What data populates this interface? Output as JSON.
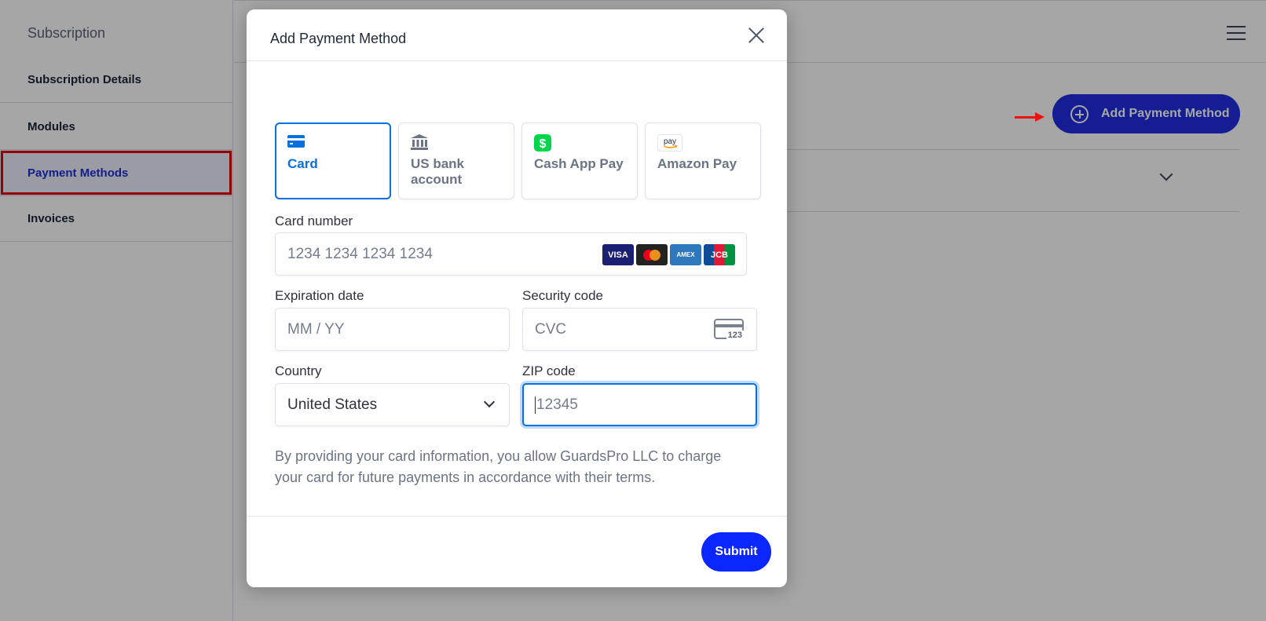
{
  "sidebar": {
    "title": "Subscription",
    "items": [
      {
        "label": "Subscription Details"
      },
      {
        "label": "Modules"
      },
      {
        "label": "Payment Methods"
      },
      {
        "label": "Invoices"
      }
    ]
  },
  "main": {
    "add_button_label": "Add Payment Method"
  },
  "modal": {
    "title": "Add Payment Method",
    "tabs": [
      {
        "label": "Card",
        "icon": "card-icon"
      },
      {
        "label": "US bank account",
        "icon": "bank-icon"
      },
      {
        "label": "Cash App Pay",
        "icon": "cash-app-icon"
      },
      {
        "label": "Amazon Pay",
        "icon": "amazon-pay-icon"
      }
    ],
    "card_number": {
      "label": "Card number",
      "placeholder": "1234 1234 1234 1234",
      "brands": [
        "VISA",
        "Mastercard",
        "AMEX",
        "JCB"
      ]
    },
    "expiration": {
      "label": "Expiration date",
      "placeholder": "MM / YY"
    },
    "security": {
      "label": "Security code",
      "placeholder": "CVC",
      "icon_text": "123"
    },
    "country": {
      "label": "Country",
      "value": "United States"
    },
    "zip": {
      "label": "ZIP code",
      "placeholder": "12345"
    },
    "terms": "By providing your card information, you allow GuardsPro LLC to charge your card for future payments in accordance with their terms.",
    "submit_label": "Submit",
    "amazon_pay_badge": "pay"
  },
  "colors": {
    "accent": "#0570de",
    "primary_button": "#1f2fe0",
    "annotation": "#ee1111"
  }
}
